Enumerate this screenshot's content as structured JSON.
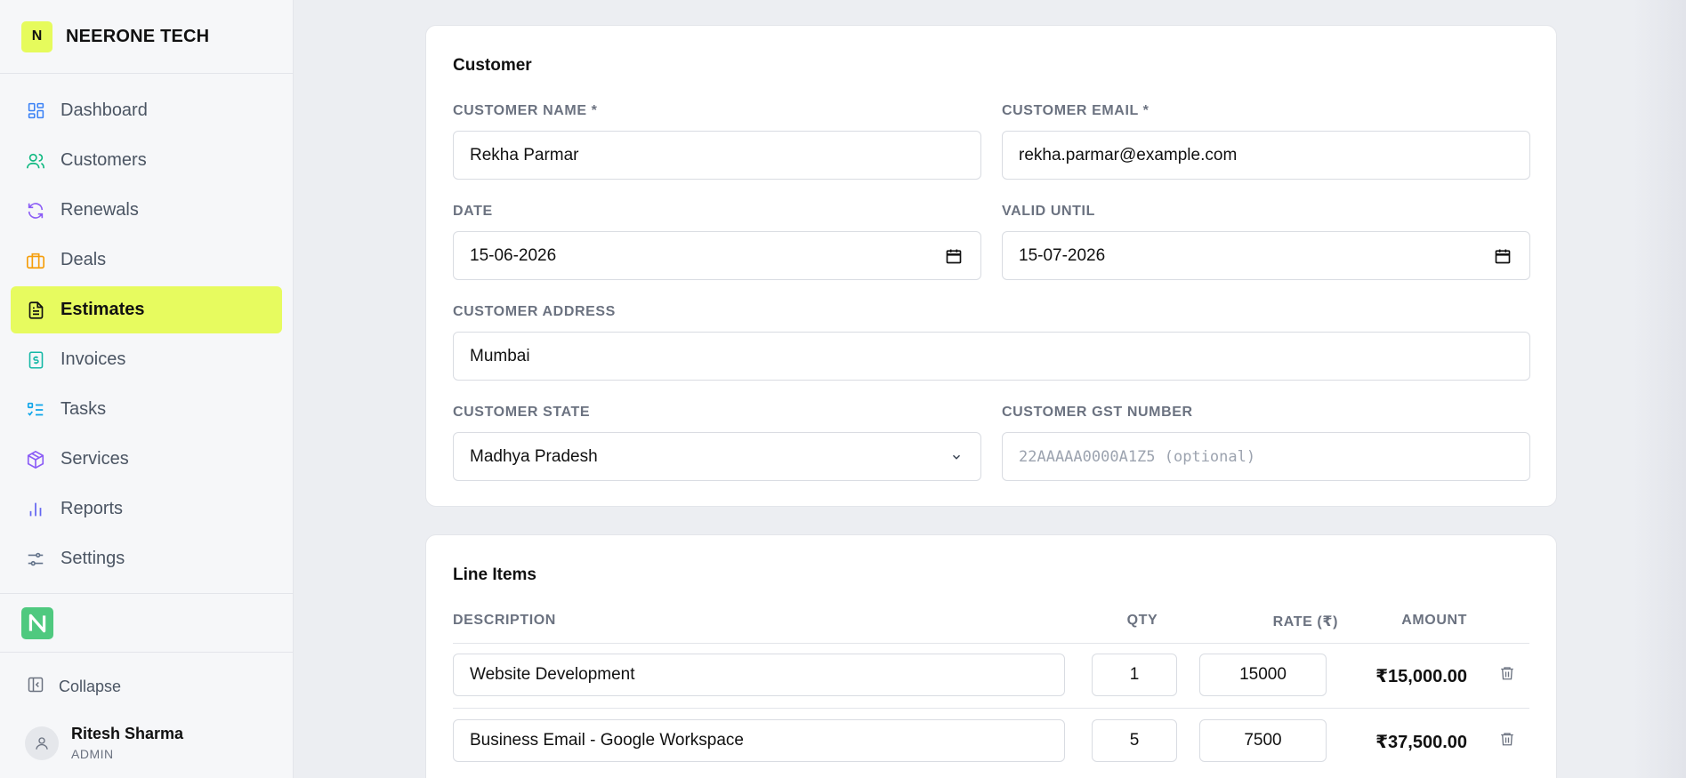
{
  "brand": {
    "mark": "N",
    "name": "NEERONE TECH"
  },
  "nav": [
    {
      "label": "Dashboard",
      "icon": "dashboard-icon",
      "color": "#3b82f6"
    },
    {
      "label": "Customers",
      "icon": "users-icon",
      "color": "#10b981"
    },
    {
      "label": "Renewals",
      "icon": "refresh-icon",
      "color": "#8b5cf6"
    },
    {
      "label": "Deals",
      "icon": "briefcase-icon",
      "color": "#f59e0b"
    },
    {
      "label": "Estimates",
      "icon": "document-icon",
      "color": "#111111",
      "active": true
    },
    {
      "label": "Invoices",
      "icon": "invoice-icon",
      "color": "#14b8a6"
    },
    {
      "label": "Tasks",
      "icon": "checklist-icon",
      "color": "#0ea5e9"
    },
    {
      "label": "Services",
      "icon": "package-icon",
      "color": "#8b5cf6"
    },
    {
      "label": "Reports",
      "icon": "bar-chart-icon",
      "color": "#6366f1"
    },
    {
      "label": "Settings",
      "icon": "sliders-icon",
      "color": "#64748b"
    }
  ],
  "sidebar": {
    "collapse_label": "Collapse"
  },
  "user": {
    "name": "Ritesh Sharma",
    "role": "ADMIN"
  },
  "customer": {
    "title": "Customer",
    "name_label": "CUSTOMER NAME *",
    "name_value": "Rekha Parmar",
    "email_label": "CUSTOMER EMAIL *",
    "email_value": "rekha.parmar@example.com",
    "date_label": "DATE",
    "date_value": "15-06-2026",
    "valid_label": "VALID UNTIL",
    "valid_value": "15-07-2026",
    "address_label": "CUSTOMER ADDRESS",
    "address_value": "Mumbai",
    "state_label": "CUSTOMER STATE",
    "state_value": "Madhya Pradesh",
    "gst_label": "CUSTOMER GST NUMBER",
    "gst_placeholder": "22AAAAA0000A1Z5 (optional)"
  },
  "line_items": {
    "title": "Line Items",
    "headers": {
      "description": "DESCRIPTION",
      "qty": "QTY",
      "rate": "RATE (₹)",
      "amount": "AMOUNT"
    },
    "rows": [
      {
        "description": "Website Development",
        "qty": "1",
        "rate": "15000",
        "amount": "₹15,000.00"
      },
      {
        "description": "Business Email - Google Workspace",
        "qty": "5",
        "rate": "7500",
        "amount": "₹37,500.00"
      }
    ]
  },
  "colors": {
    "accent": "#e7fb5f",
    "logo_green": "#4fc97f"
  }
}
